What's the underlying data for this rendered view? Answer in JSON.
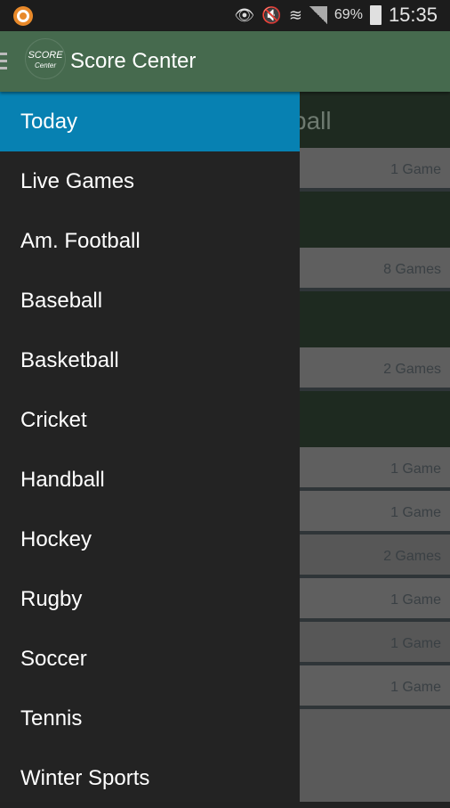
{
  "status_bar": {
    "battery": "69%",
    "time": "15:35",
    "icons": [
      "app-notification-icon",
      "eye-icon",
      "mute-icon",
      "wifi-icon",
      "signal-icon",
      "battery-icon"
    ]
  },
  "app_bar": {
    "title": "Score Center",
    "logo_text": "SCORE",
    "logo_subtext": "Center"
  },
  "drawer": {
    "items": [
      {
        "label": "Today",
        "active": true
      },
      {
        "label": "Live Games"
      },
      {
        "label": "Am. Football"
      },
      {
        "label": "Baseball"
      },
      {
        "label": "Basketball"
      },
      {
        "label": "Cricket"
      },
      {
        "label": "Handball"
      },
      {
        "label": "Hockey"
      },
      {
        "label": "Rugby"
      },
      {
        "label": "Soccer"
      },
      {
        "label": "Tennis"
      },
      {
        "label": "Winter Sports"
      }
    ]
  },
  "background": {
    "first_header": "ball",
    "rows": [
      "1 Game",
      "8 Games",
      "2 Games",
      "1 Game",
      "1 Game",
      "2 Games",
      "1 Game",
      "1 Game",
      "1 Game"
    ]
  },
  "colors": {
    "app_bar": "#466a4e",
    "active_item": "#0781b2",
    "drawer": "#232323"
  }
}
